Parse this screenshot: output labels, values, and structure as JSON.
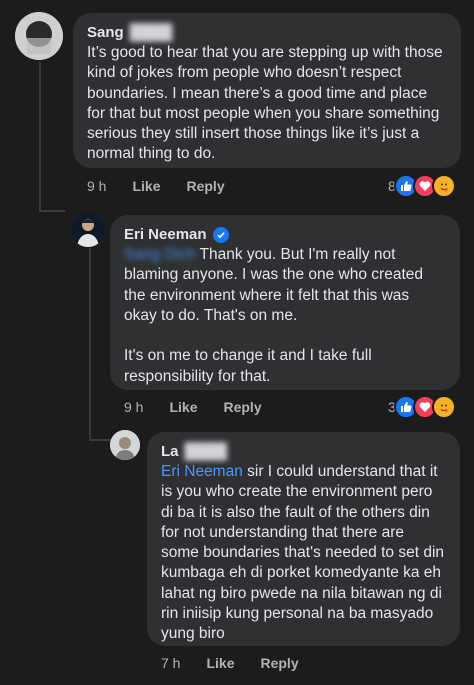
{
  "comments": [
    {
      "author": "Sang",
      "author_blurred": "████",
      "text": "It’s good to hear that you are stepping up with those kind of jokes from people who doesn’t respect boundaries. I mean there’s a good time and place for that but most people when you share something serious they still insert those things like it’s just a normal thing to do.",
      "time": "9 h",
      "like_label": "Like",
      "reply_label": "Reply",
      "reaction_count": "8",
      "reactions": [
        "like-icon",
        "love-icon",
        "care-icon"
      ]
    },
    {
      "author": "Eri Neeman",
      "verified": true,
      "mention": "Sang Dich",
      "text_after_mention": " Thank you. But I'm really not blaming anyone. I was the one who created the environment where it felt that this was okay to do. That's on me.\n\nIt's on me to change it and I take full responsibility for that.",
      "time": "9 h",
      "like_label": "Like",
      "reply_label": "Reply",
      "reaction_count": "3",
      "reactions": [
        "like-icon",
        "love-icon",
        "care-icon"
      ]
    },
    {
      "author": "La",
      "author_blurred": "████",
      "mention": "Eri Neeman",
      "text_after_mention": " sir I could understand that it is you who create the environment pero di ba it is also the fault of the others din for not understanding that there are some boundaries that's needed to set din kumbaga eh di porket komedyante ka eh lahat ng biro pwede na nila bitawan ng di rin iniisip kung personal na ba masyado yung biro",
      "time": "7 h",
      "like_label": "Like",
      "reply_label": "Reply"
    }
  ],
  "colors": {
    "background": "#1c1c1d",
    "bubble": "#2f3031",
    "mention": "#4599ff",
    "secondary_text": "#b0b3b8",
    "like_blue": "#1877f2",
    "love_red": "#f33e58",
    "care_yellow": "#f7b125"
  }
}
